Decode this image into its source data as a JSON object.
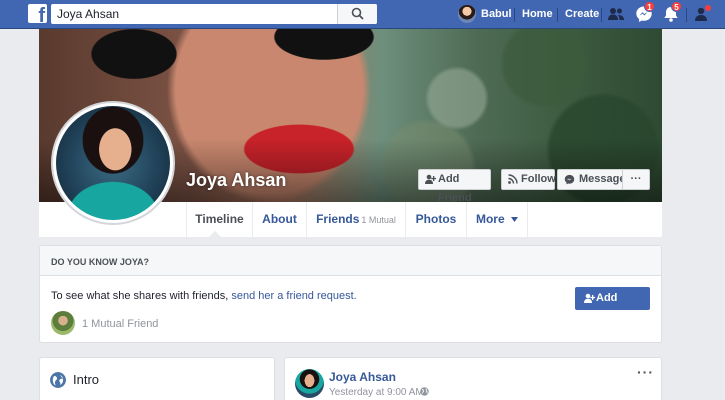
{
  "topbar": {
    "search_value": "Joya Ahsan",
    "profile_name": "Babul",
    "home_label": "Home",
    "create_label": "Create",
    "messages_badge": "1",
    "notifications_badge": "5",
    "colors": {
      "bar": "#4267b2",
      "badge": "#fa3e3e"
    }
  },
  "profile": {
    "name": "Joya Ahsan",
    "add_friend_label": "Add Friend",
    "follow_label": "Follow",
    "message_label": "Message",
    "more_label": "···"
  },
  "tabs": {
    "timeline": "Timeline",
    "about": "About",
    "friends": "Friends",
    "friends_mutual": "1 Mutual",
    "photos": "Photos",
    "more": "More"
  },
  "know": {
    "title": "DO YOU KNOW JOYA?",
    "text_prefix": "To see what she shares with friends, ",
    "text_link": "send her a friend request.",
    "add_friend_label": "Add Friend",
    "mutual_text": "1 Mutual Friend"
  },
  "intro": {
    "title": "Intro"
  },
  "post": {
    "author": "Joya Ahsan",
    "time": "Yesterday at 9:00 AM ·",
    "more": "···"
  }
}
